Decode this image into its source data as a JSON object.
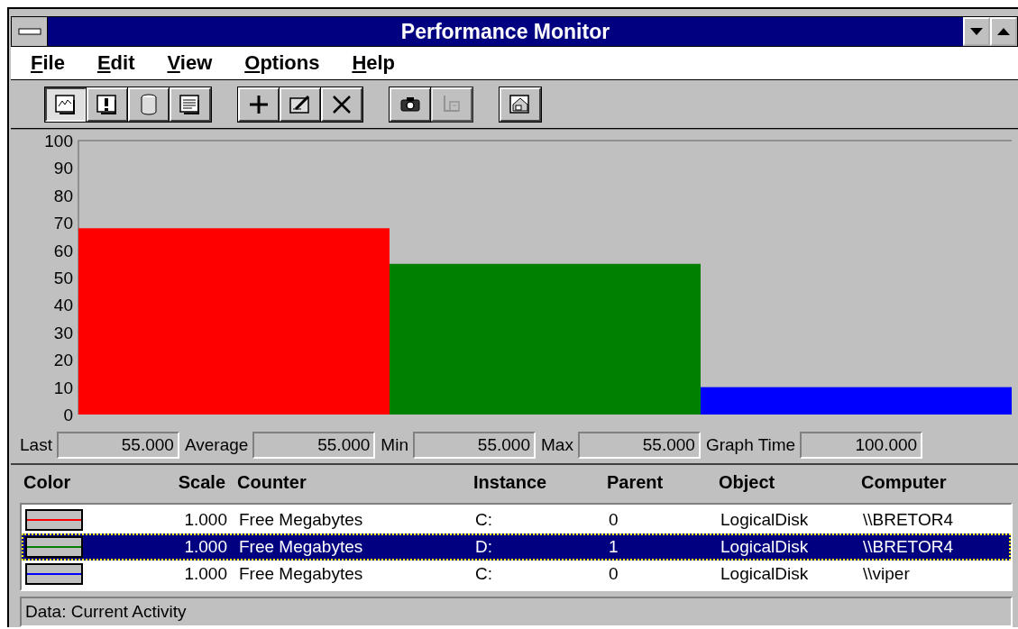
{
  "window": {
    "title": "Performance Monitor"
  },
  "menu": [
    "File",
    "Edit",
    "View",
    "Options",
    "Help"
  ],
  "toolbar": [
    [
      {
        "kind": "chart",
        "selected": true,
        "disabled": false
      },
      {
        "kind": "alert",
        "selected": false,
        "disabled": false
      },
      {
        "kind": "log",
        "selected": false,
        "disabled": false
      },
      {
        "kind": "report",
        "selected": false,
        "disabled": false
      }
    ],
    [
      {
        "kind": "add",
        "selected": false,
        "disabled": false
      },
      {
        "kind": "edit",
        "selected": false,
        "disabled": false
      },
      {
        "kind": "delete",
        "selected": false,
        "disabled": false
      }
    ],
    [
      {
        "kind": "snapshot",
        "selected": false,
        "disabled": false
      },
      {
        "kind": "export",
        "selected": false,
        "disabled": true
      }
    ],
    [
      {
        "kind": "options",
        "selected": false,
        "disabled": false
      }
    ]
  ],
  "chart": {
    "chart_data": {
      "type": "bar",
      "values": [
        68,
        55,
        10
      ],
      "ylim": [
        0,
        100
      ],
      "yticks": [
        0,
        10,
        20,
        30,
        40,
        50,
        60,
        70,
        80,
        90,
        100
      ]
    }
  },
  "stats": [
    {
      "label": "Last",
      "value": "55.000"
    },
    {
      "label": "Average",
      "value": "55.000"
    },
    {
      "label": "Min",
      "value": "55.000"
    },
    {
      "label": "Max",
      "value": "55.000"
    },
    {
      "label": "Graph Time",
      "value": "100.000"
    }
  ],
  "table": {
    "columns": [
      "Color",
      "Scale",
      "Counter",
      "Instance",
      "Parent",
      "Object",
      "Computer"
    ],
    "rows": [
      {
        "color": "#ff0000",
        "scale": "1.000",
        "counter": "Free Megabytes",
        "instance": "C:",
        "parent": "0",
        "object": "LogicalDisk",
        "computer": "\\\\BRETOR4",
        "selected": false
      },
      {
        "color": "#008000",
        "scale": "1.000",
        "counter": "Free Megabytes",
        "instance": "D:",
        "parent": "1",
        "object": "LogicalDisk",
        "computer": "\\\\BRETOR4",
        "selected": true
      },
      {
        "color": "#0000ff",
        "scale": "1.000",
        "counter": "Free Megabytes",
        "instance": "C:",
        "parent": "0",
        "object": "LogicalDisk",
        "computer": "\\\\viper",
        "selected": false
      }
    ]
  },
  "status_bar": "Data: Current Activity"
}
